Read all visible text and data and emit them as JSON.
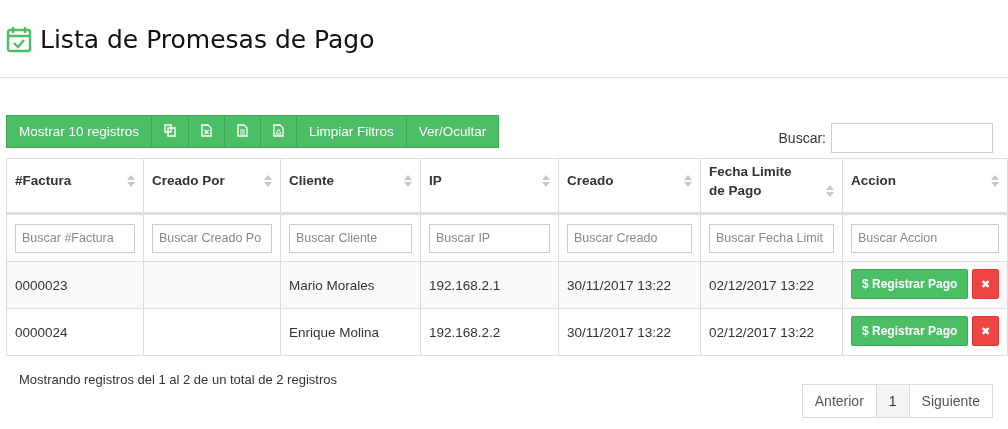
{
  "page": {
    "title": "Lista de Promesas de Pago"
  },
  "toolbar": {
    "buttons": [
      {
        "kind": "text",
        "label": "Mostrar 10 registros"
      },
      {
        "kind": "copy"
      },
      {
        "kind": "excel"
      },
      {
        "kind": "csv"
      },
      {
        "kind": "pdf"
      },
      {
        "kind": "text",
        "label": "Limpiar Filtros"
      },
      {
        "kind": "text",
        "label": "Ver/Ocultar"
      }
    ]
  },
  "search": {
    "label": "Buscar:"
  },
  "table": {
    "columns": [
      {
        "label": "#Factura",
        "filter_placeholder": "Buscar #Factura"
      },
      {
        "label": "Creado Por",
        "filter_placeholder": "Buscar Creado Po"
      },
      {
        "label": "Cliente",
        "filter_placeholder": "Buscar Cliente"
      },
      {
        "label": "IP",
        "filter_placeholder": "Buscar IP"
      },
      {
        "label": "Creado",
        "filter_placeholder": "Buscar Creado"
      },
      {
        "label": "Fecha Limite de Pago",
        "filter_placeholder": "Buscar Fecha Limit"
      },
      {
        "label": "Accion",
        "filter_placeholder": "Buscar Accion"
      }
    ],
    "rows": [
      {
        "cells": [
          "0000023",
          "",
          "Mario Morales",
          "192.168.2.1",
          "30/11/2017 13:22",
          "02/12/2017 13:22"
        ],
        "pay_button": "$ Registrar Pago",
        "delete_button": "✖"
      },
      {
        "cells": [
          "0000024",
          "",
          "Enrique Molina",
          "192.168.2.2",
          "30/11/2017 13:22",
          "02/12/2017 13:22"
        ],
        "pay_button": "$ Registrar Pago",
        "delete_button": "✖"
      }
    ]
  },
  "info": "Mostrando registros del 1 al 2 de un total de 2 registros",
  "pagination": {
    "previous": "Anterior",
    "pages": [
      {
        "label": "1",
        "selected": true
      }
    ],
    "next": "Siguiente"
  }
}
